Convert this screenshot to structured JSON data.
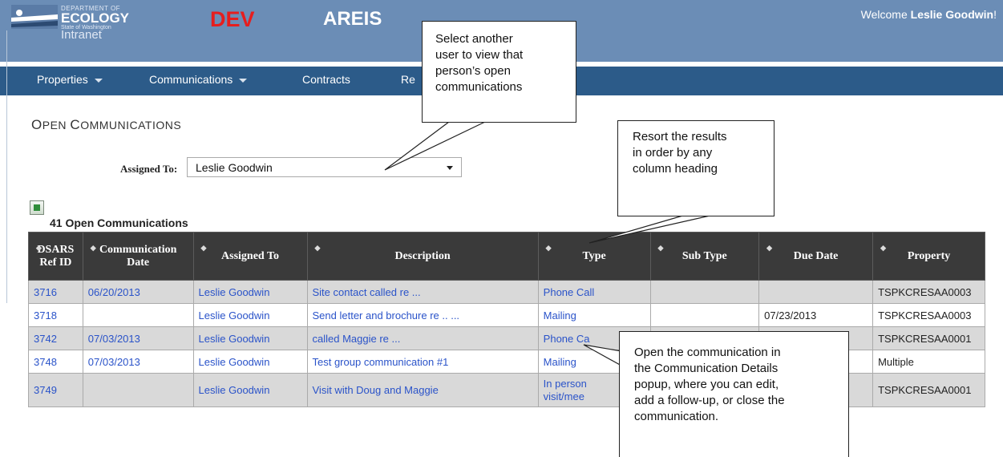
{
  "header": {
    "logo_dept": "DEPARTMENT OF",
    "logo_ecology": "ECOLOGY",
    "logo_intranet": "Intranet",
    "logo_state": "State of Washington",
    "env_label": "DEV",
    "app_name": "AREIS",
    "welcome_prefix": "Welcome ",
    "welcome_user": "Leslie Goodwin",
    "welcome_suffix": "!"
  },
  "nav": {
    "items": [
      {
        "label": "Properties"
      },
      {
        "label": "Communications"
      },
      {
        "label": "Contracts"
      },
      {
        "label": "Re"
      }
    ]
  },
  "page": {
    "title_big_o": "O",
    "title_pen": "PEN ",
    "title_big_c": "C",
    "title_rest": "OMMUNICATIONS",
    "assigned_label": "Assigned To:",
    "assigned_value": "Leslie Goodwin",
    "count_text": "41 Open Communications"
  },
  "table": {
    "headers": [
      {
        "label": "DSARS Ref ID"
      },
      {
        "label": "Communication Date"
      },
      {
        "label": "Assigned To"
      },
      {
        "label": "Description"
      },
      {
        "label": "Type"
      },
      {
        "label": "Sub Type"
      },
      {
        "label": "Due Date"
      },
      {
        "label": "Property"
      }
    ],
    "rows": [
      {
        "id": "3716",
        "date": "06/20/2013",
        "assigned": "Leslie Goodwin",
        "desc": "Site contact called re ...",
        "type": "Phone Call",
        "subtype": "",
        "due": "",
        "property": "TSPKCRESAA0003"
      },
      {
        "id": "3718",
        "date": "",
        "assigned": "Leslie Goodwin",
        "desc": "Send letter and brochure re .. ...",
        "type": "Mailing",
        "subtype": "",
        "due": "07/23/2013",
        "property": "TSPKCRESAA0003"
      },
      {
        "id": "3742",
        "date": "07/03/2013",
        "assigned": "Leslie Goodwin",
        "desc": "called Maggie re ...",
        "type": "Phone Ca",
        "subtype": "",
        "due": "",
        "property": "TSPKCRESAA0001"
      },
      {
        "id": "3748",
        "date": "07/03/2013",
        "assigned": "Leslie Goodwin",
        "desc": "Test group communication #1",
        "type": "Mailing",
        "subtype": "",
        "due": "",
        "property": "Multiple"
      },
      {
        "id": "3749",
        "date": "",
        "assigned": "Leslie Goodwin",
        "desc": "Visit with Doug and Maggie",
        "type_line1": "In person",
        "type_line2": "visit/mee",
        "subtype": "",
        "due": "",
        "property": "TSPKCRESAA0001"
      }
    ]
  },
  "callouts": {
    "select_user": [
      "Select another",
      "user to view that",
      "person’s open",
      "communications"
    ],
    "resort": [
      "Resort the results",
      "in order by any",
      "column heading"
    ],
    "open_comm": [
      "Open the communication in",
      "the Communication Details",
      "popup, where you can edit,",
      "add a follow-up, or close the",
      "communication."
    ]
  },
  "icons": {
    "sort": "sort-arrows-icon",
    "excel": "excel-export-icon",
    "dropdown": "chevron-down-icon"
  },
  "colors": {
    "header_bg": "#6e8fb8",
    "nav_bg": "#2c5b89",
    "dev_red": "#e61e1e",
    "link_blue": "#2a53c9",
    "table_header": "#3a3a3a"
  }
}
